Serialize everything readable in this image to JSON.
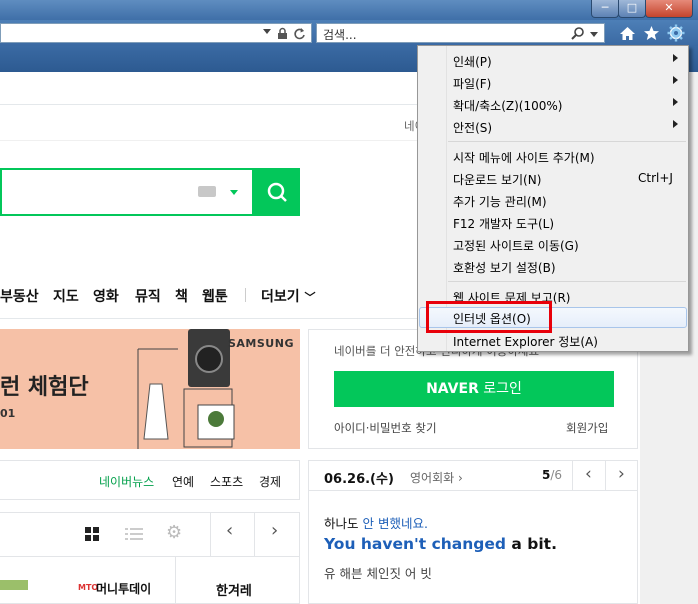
{
  "browser": {
    "window_buttons": {
      "minimize": "─",
      "maximize": "□",
      "close": "✕"
    },
    "search_placeholder": "검색...",
    "icons": [
      "home-icon",
      "star-icon",
      "gear-icon"
    ]
  },
  "naver": {
    "partial_text_top": "네이",
    "nav_items": [
      "부동산",
      "지도",
      "영화",
      "뮤직",
      "책",
      "웹툰"
    ],
    "nav_more": "더보기",
    "banner": {
      "title_fragment": "런 체험단",
      "subtitle_fragment": "01",
      "brand": "SAMSUNG"
    },
    "login": {
      "notice": "네이버를 더 안전하고 편리하게 이용하세요",
      "button_brand": "NAVER",
      "button_text": " 로그인",
      "find_link": "아이디·비밀번호 찾기",
      "signup_link": "회원가입"
    },
    "news_tabs": [
      "네이버뉴스",
      "연예",
      "스포츠",
      "경제"
    ],
    "media_logos": [
      "머니투데이",
      "한겨레"
    ],
    "media_logo_prefix": "MTO",
    "english": {
      "date": "06.26.(수)",
      "category": "영어회화",
      "page_current": "5",
      "page_total": "/6",
      "korean_plain": "하나도 ",
      "korean_link": "안 변했네요.",
      "english_bold_blue": "You haven't changed",
      "english_rest": " a bit.",
      "pronunciation": "유 해븐 체인짓 어 빗"
    }
  },
  "menu": {
    "items": [
      {
        "label": "인쇄(P)",
        "shortcut": "",
        "submenu": true
      },
      {
        "label": "파일(F)",
        "shortcut": "",
        "submenu": true
      },
      {
        "label": "확대/축소(Z)(100%)",
        "shortcut": "",
        "submenu": true
      },
      {
        "label": "안전(S)",
        "shortcut": "",
        "submenu": true
      },
      {
        "label": "시작 메뉴에 사이트 추가(M)",
        "shortcut": "",
        "submenu": false
      },
      {
        "label": "다운로드 보기(N)",
        "shortcut": "Ctrl+J",
        "submenu": false
      },
      {
        "label": "추가 기능 관리(M)",
        "shortcut": "",
        "submenu": false
      },
      {
        "label": "F12 개발자 도구(L)",
        "shortcut": "",
        "submenu": false
      },
      {
        "label": "고정된 사이트로 이동(G)",
        "shortcut": "",
        "submenu": false
      },
      {
        "label": "호환성 보기 설정(B)",
        "shortcut": "",
        "submenu": false
      },
      {
        "label": "웹 사이트 문제 보고(R)",
        "shortcut": "",
        "submenu": false
      },
      {
        "label": "인터넷 옵션(O)",
        "shortcut": "",
        "submenu": false
      },
      {
        "label": "Internet Explorer 정보(A)",
        "shortcut": "",
        "submenu": false
      }
    ],
    "highlight_color": "#e8000a"
  }
}
